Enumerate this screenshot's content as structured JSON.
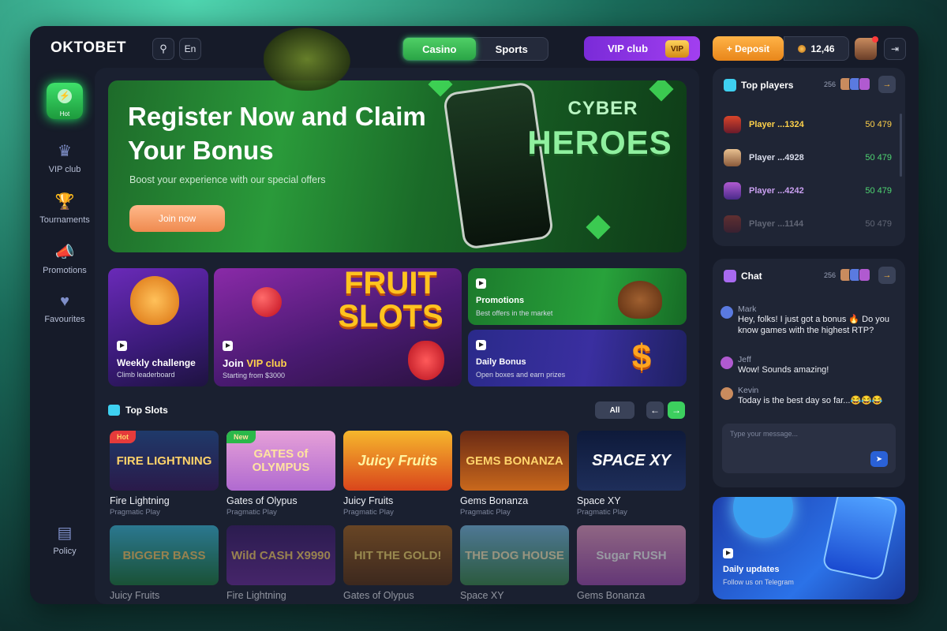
{
  "header": {
    "logo": "OKTOBET",
    "lang": "En",
    "tabs": [
      {
        "label": "Casino",
        "active": true
      },
      {
        "label": "Sports",
        "active": false
      }
    ],
    "vip_label": "VIP club",
    "vip_badge": "VIP",
    "deposit_label": "+ Deposit",
    "balance": "12,46"
  },
  "sidebar": {
    "hot_label": "Hot",
    "items": [
      {
        "label": "VIP club",
        "icon": "crown-icon"
      },
      {
        "label": "Tournaments",
        "icon": "trophy-icon"
      },
      {
        "label": "Promotions",
        "icon": "megaphone-icon"
      },
      {
        "label": "Favourites",
        "icon": "heart-icon"
      }
    ],
    "policy_label": "Policy"
  },
  "hero": {
    "title": "Register Now and Claim Your Bonus",
    "subtitle": "Boost your experience with our special offers",
    "cta": "Join now",
    "art_line1": "CYBER",
    "art_line2": "HEROES"
  },
  "promos": {
    "weekly": {
      "title": "Weekly challenge",
      "sub": "Climb leaderboard"
    },
    "vip": {
      "title_pre": "Join ",
      "title_hl": "VIP club",
      "sub": "Starting from $3000",
      "art": "FRUIT SLOTS"
    },
    "promotions": {
      "title": "Promotions",
      "sub": "Best offers in the market"
    },
    "daily": {
      "title": "Daily Bonus",
      "sub": "Open boxes and earn prizes"
    }
  },
  "top_slots": {
    "title": "Top Slots",
    "all_label": "All",
    "games": [
      {
        "name": "Fire Lightning",
        "provider": "Pragmatic Play",
        "tag": "Hot",
        "art": "FIRE LIGHTNING"
      },
      {
        "name": "Gates of Olypus",
        "provider": "Pragmatic Play",
        "tag": "New",
        "art": "GATES of OLYMPUS"
      },
      {
        "name": "Juicy Fruits",
        "provider": "Pragmatic Play",
        "tag": "",
        "art": "Juicy Fruits"
      },
      {
        "name": "Gems Bonanza",
        "provider": "Pragmatic Play",
        "tag": "",
        "art": "GEMS BONANZA"
      },
      {
        "name": "Space XY",
        "provider": "Pragmatic Play",
        "tag": "",
        "art": "SPACE XY"
      }
    ],
    "games_row2": [
      {
        "name": "Juicy Fruits",
        "art": "BIGGER BASS"
      },
      {
        "name": "Fire Lightning",
        "art": "Wild CASH X9990"
      },
      {
        "name": "Gates of Olypus",
        "art": "HIT THE GOLD!"
      },
      {
        "name": "Space XY",
        "art": "THE DOG HOUSE"
      },
      {
        "name": "Gems Bonanza",
        "art": "Sugar RUSH"
      }
    ]
  },
  "top_players": {
    "title": "Top players",
    "count": "256",
    "players": [
      {
        "name": "Player ...1324",
        "score": "50 479"
      },
      {
        "name": "Player ...4928",
        "score": "50 479"
      },
      {
        "name": "Player ...4242",
        "score": "50 479"
      },
      {
        "name": "Player ...1144",
        "score": "50 479"
      }
    ]
  },
  "chat": {
    "title": "Chat",
    "count": "256",
    "messages": [
      {
        "user": "Mark",
        "text": "Hey, folks! I just got a bonus 🔥 Do you know games with the highest RTP?"
      },
      {
        "user": "Jeff",
        "text": "Wow! Sounds amazing!"
      },
      {
        "user": "Kevin",
        "text": "Today is the best day so far...😂😂😂"
      }
    ],
    "placeholder": "Type your message..."
  },
  "telegram": {
    "title": "Daily updates",
    "sub": "Follow us on Telegram"
  },
  "colors": {
    "accent_green": "#3ee06a",
    "vip_purple": "#a23ff0",
    "deposit_orange": "#ffb347",
    "bg": "#161b29"
  }
}
